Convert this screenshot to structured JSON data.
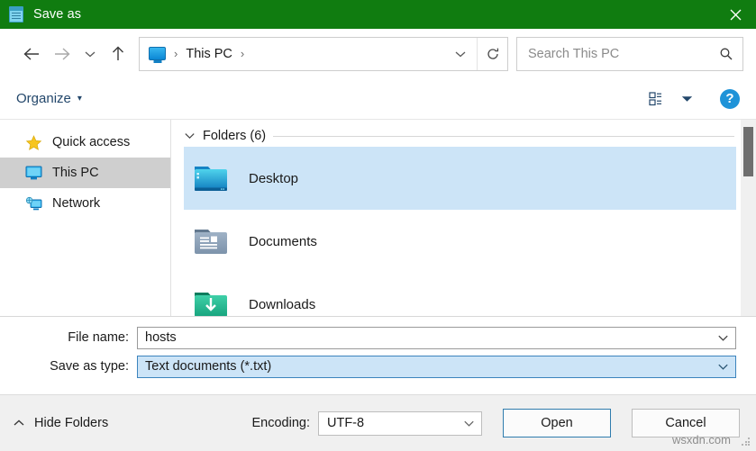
{
  "window": {
    "title": "Save as",
    "title_icon": "notepad-icon",
    "close_label": "✕",
    "titlebar_color": "#107c10"
  },
  "nav": {
    "back_icon": "arrow-left-icon",
    "forward_icon": "arrow-right-icon",
    "recent_icon": "chevron-down-icon",
    "up_icon": "arrow-up-icon",
    "breadcrumb": {
      "root_icon": "this-pc-icon",
      "sep1": "›",
      "label": "This PC",
      "sep2": "›"
    },
    "address_dropdown_icon": "chevron-down-icon",
    "refresh_icon": "refresh-icon"
  },
  "search": {
    "placeholder": "Search This PC",
    "value": "",
    "icon": "search-icon"
  },
  "toolbar": {
    "organize_label": "Organize",
    "organize_caret": "▾",
    "view_icon": "view-details-icon",
    "view_caret_icon": "chevron-down-icon",
    "help_label": "?",
    "help_color": "#1f93d8"
  },
  "sidebar": {
    "items": [
      {
        "label": "Quick access",
        "icon": "star-icon",
        "selected": false
      },
      {
        "label": "This PC",
        "icon": "this-pc-icon",
        "selected": true
      },
      {
        "label": "Network",
        "icon": "network-icon",
        "selected": false
      }
    ]
  },
  "filelist": {
    "group": {
      "collapse_icon": "chevron-down-icon",
      "label": "Folders (6)"
    },
    "items": [
      {
        "label": "Desktop",
        "icon": "folder-desktop-icon",
        "selected": true
      },
      {
        "label": "Documents",
        "icon": "folder-documents-icon",
        "selected": false
      },
      {
        "label": "Downloads",
        "icon": "folder-downloads-icon",
        "selected": false
      }
    ],
    "selection_color": "#cce4f7",
    "scrollbar": {
      "visible": true
    }
  },
  "fields": {
    "filename": {
      "label": "File name:",
      "value": "hosts",
      "caret_icon": "chevron-down-icon"
    },
    "savetype": {
      "label": "Save as type:",
      "value": "Text documents (*.txt)",
      "caret_icon": "chevron-down-icon",
      "highlighted": true
    }
  },
  "footer": {
    "hide_folders_label": "Hide Folders",
    "hide_folders_icon": "chevron-up-icon",
    "encoding_label": "Encoding:",
    "encoding_value": "UTF-8",
    "encoding_caret_icon": "chevron-down-icon",
    "open_label": "Open",
    "cancel_label": "Cancel",
    "watermark": "wsxdn.com"
  }
}
